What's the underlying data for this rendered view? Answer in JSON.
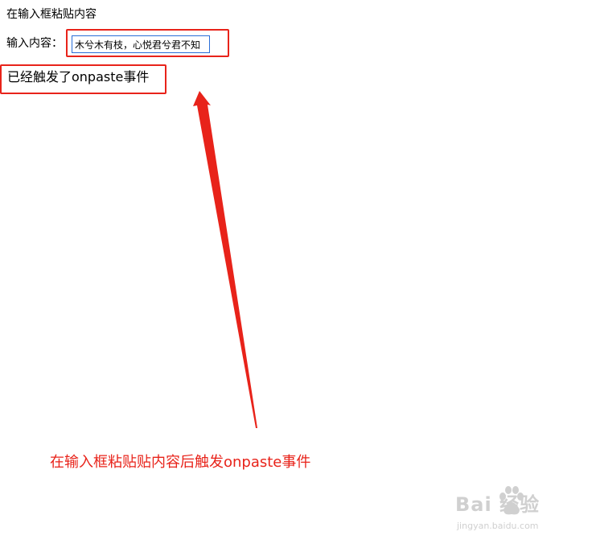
{
  "page": {
    "heading": "在输入框粘贴内容",
    "input_label": "输入内容：",
    "input_value": "木兮木有枝，心悦君兮君不知",
    "result_message": "已经触发了onpaste事件"
  },
  "annotation": {
    "caption": "在输入框粘贴贴内容后触发onpaste事件",
    "color": "#e8231a",
    "arrow_icon": "arrow-up-icon"
  },
  "watermark": {
    "logo_text": "Bai  经验",
    "sub_text": "jingyan.baidu.com",
    "icon": "paw-icon"
  }
}
